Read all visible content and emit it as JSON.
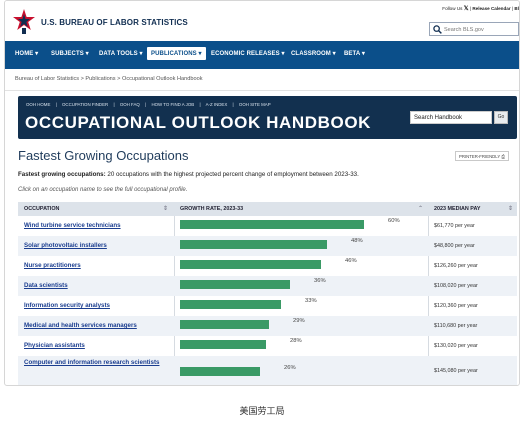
{
  "header": {
    "agency_name": "U.S. BUREAU OF LABOR STATISTICS",
    "follow_text": "Follow Us",
    "x_icon": "x-icon",
    "release_calendar": "Release Calendar",
    "blog": "Bl",
    "search_placeholder": "Search BLS.gov"
  },
  "nav": {
    "items": [
      {
        "label": "HOME ▾"
      },
      {
        "label": "SUBJECTS ▾"
      },
      {
        "label": "DATA TOOLS ▾"
      },
      {
        "label": "PUBLICATIONS ▾"
      },
      {
        "label": "ECONOMIC RELEASES ▾"
      },
      {
        "label": "CLASSROOM ▾"
      },
      {
        "label": "BETA ▾"
      }
    ]
  },
  "breadcrumb": "Bureau of Labor Statistics > Publications > Occupational Outlook Handbook",
  "ooh": {
    "links": [
      "OOH HOME",
      "|",
      "OCCUPATION FINDER",
      "|",
      "OOH FAQ",
      "|",
      "HOW TO FIND A JOB",
      "|",
      "A-Z INDEX",
      "|",
      "OOH SITE MAP"
    ],
    "title": "OCCUPATIONAL OUTLOOK HANDBOOK",
    "search_value": "Search Handbook",
    "go_label": "Go"
  },
  "page": {
    "title": "Fastest Growing Occupations",
    "printer_friendly": "PRINTER-FRIENDLY",
    "summary_bold": "Fastest growing occupations:",
    "summary_rest": " 20 occupations with the highest projected percent change of employment between 2023-33.",
    "hint": "Click on an occupation name to see the full occupational profile."
  },
  "table": {
    "col_occupation": "OCCUPATION",
    "col_growth": "GROWTH RATE, 2023-33",
    "col_pay": "2023 MEDIAN PAY",
    "rows": [
      {
        "occupation": "Wind turbine service technicians",
        "growth": 60,
        "growth_label": "60%",
        "pay": "$61,770 per year"
      },
      {
        "occupation": "Solar photovoltaic installers",
        "growth": 48,
        "growth_label": "48%",
        "pay": "$48,800 per year"
      },
      {
        "occupation": "Nurse practitioners",
        "growth": 46,
        "growth_label": "46%",
        "pay": "$126,260 per year"
      },
      {
        "occupation": "Data scientists",
        "growth": 36,
        "growth_label": "36%",
        "pay": "$108,020 per year"
      },
      {
        "occupation": "Information security analysts",
        "growth": 33,
        "growth_label": "33%",
        "pay": "$120,360 per year"
      },
      {
        "occupation": "Medical and health services managers",
        "growth": 29,
        "growth_label": "29%",
        "pay": "$110,680 per year"
      },
      {
        "occupation": "Physician assistants",
        "growth": 28,
        "growth_label": "28%",
        "pay": "$130,020 per year"
      },
      {
        "occupation": "Computer and information research scientists",
        "growth": 26,
        "growth_label": "26%",
        "pay": "$145,080 per year"
      }
    ]
  },
  "caption": "美国劳工局",
  "colors": {
    "nav": "#0b4f8a",
    "banner": "#12304f",
    "bar": "#3a9a66",
    "link": "#1a3d8f"
  }
}
